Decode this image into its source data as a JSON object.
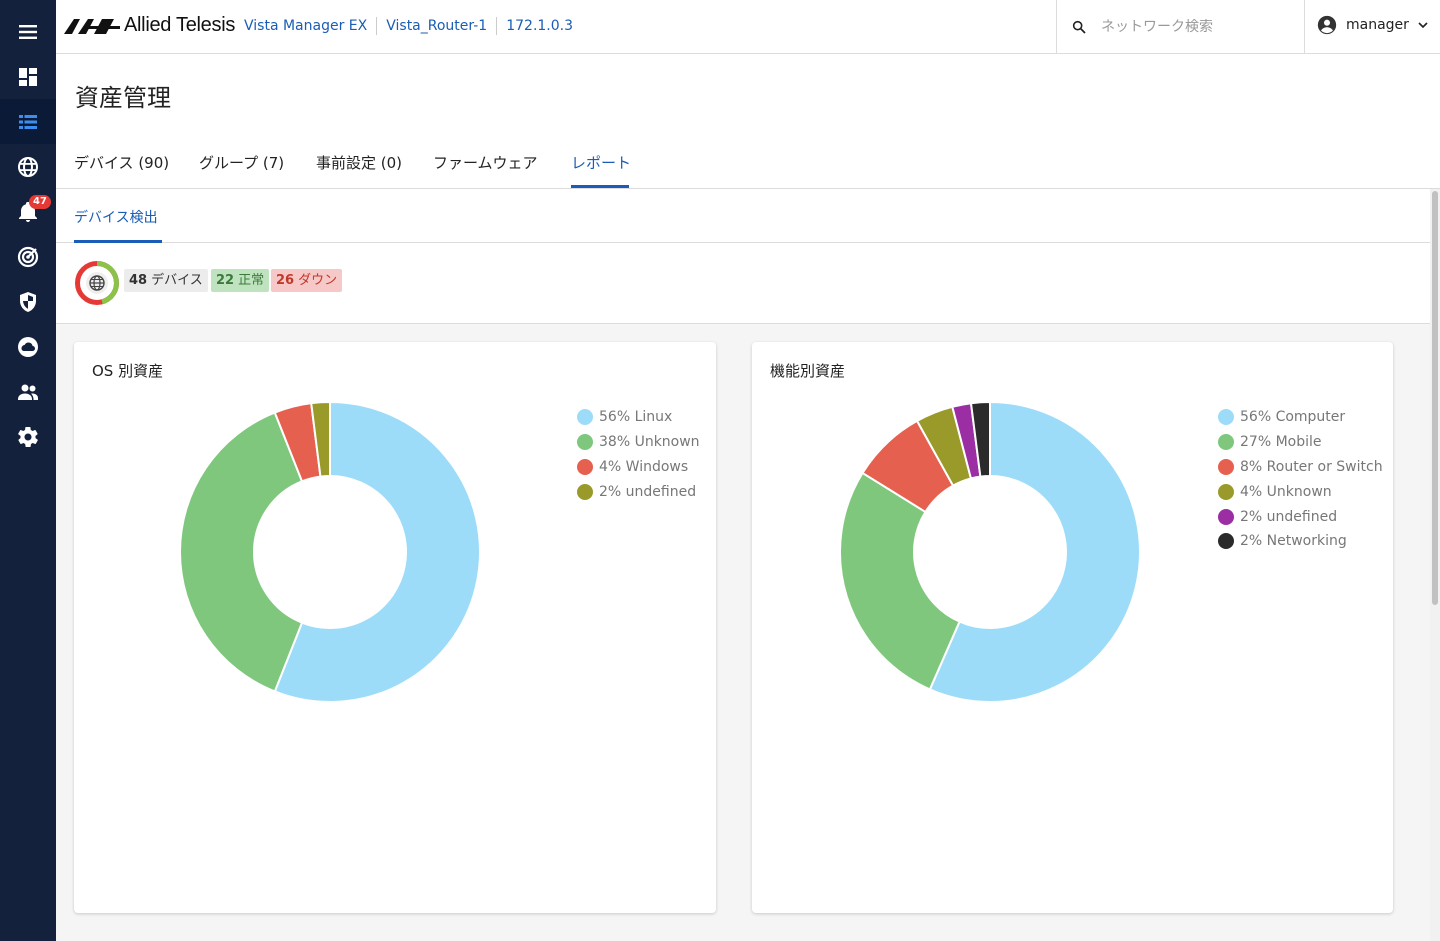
{
  "app": {
    "logo_text": "Allied Telesis",
    "breadcrumbs": [
      "Vista Manager EX",
      "Vista_Router-1",
      "172.1.0.3"
    ],
    "search_placeholder": "ネットワーク検索",
    "user": "manager",
    "alert_count": "47"
  },
  "sidebar": {
    "items": [
      {
        "name": "menu-icon"
      },
      {
        "name": "dashboard-icon"
      },
      {
        "name": "asset-list-icon",
        "active": true
      },
      {
        "name": "globe-icon"
      },
      {
        "name": "bell-icon"
      },
      {
        "name": "radar-icon"
      },
      {
        "name": "shield-icon"
      },
      {
        "name": "cloud-icon"
      },
      {
        "name": "users-icon"
      },
      {
        "name": "gear-icon"
      }
    ]
  },
  "page": {
    "title": "資産管理",
    "tabs": [
      {
        "label": "デバイス (90)"
      },
      {
        "label": "グループ (7)"
      },
      {
        "label": "事前設定 (0)"
      },
      {
        "label": "ファームウェア"
      },
      {
        "label": "レポート",
        "active": true
      }
    ],
    "subtab": "デバイス検出"
  },
  "summary": {
    "total_count": "48",
    "total_label": "デバイス",
    "ok_count": "22",
    "ok_label": "正常",
    "down_count": "26",
    "down_label": "ダウン"
  },
  "colors": {
    "accent": "#1a5db6",
    "sidebar": "#14213d"
  },
  "chart_data": [
    {
      "type": "pie",
      "title": "OS 別資産",
      "categories": [
        "Linux",
        "Unknown",
        "Windows",
        "undefined"
      ],
      "values": [
        56,
        38,
        4,
        2
      ],
      "legend": [
        "56% Linux",
        "38% Unknown",
        "4% Windows",
        "2% undefined"
      ],
      "colors": [
        "#9ddcf9",
        "#7fc77d",
        "#e6604f",
        "#9a9a2a"
      ],
      "legend_position": "top-right"
    },
    {
      "type": "pie",
      "title": "機能別資産",
      "categories": [
        "Computer",
        "Mobile",
        "Router or Switch",
        "Unknown",
        "undefined",
        "Networking"
      ],
      "values": [
        56,
        27,
        8,
        4,
        2,
        2
      ],
      "legend": [
        "56% Computer",
        "27% Mobile",
        "8% Router or Switch",
        "4% Unknown",
        "2% undefined",
        "2% Networking"
      ],
      "colors": [
        "#9ddcf9",
        "#7fc77d",
        "#e6604f",
        "#9a9a2a",
        "#9b2ea3",
        "#2b2b2b"
      ],
      "legend_position": "top-right"
    }
  ]
}
